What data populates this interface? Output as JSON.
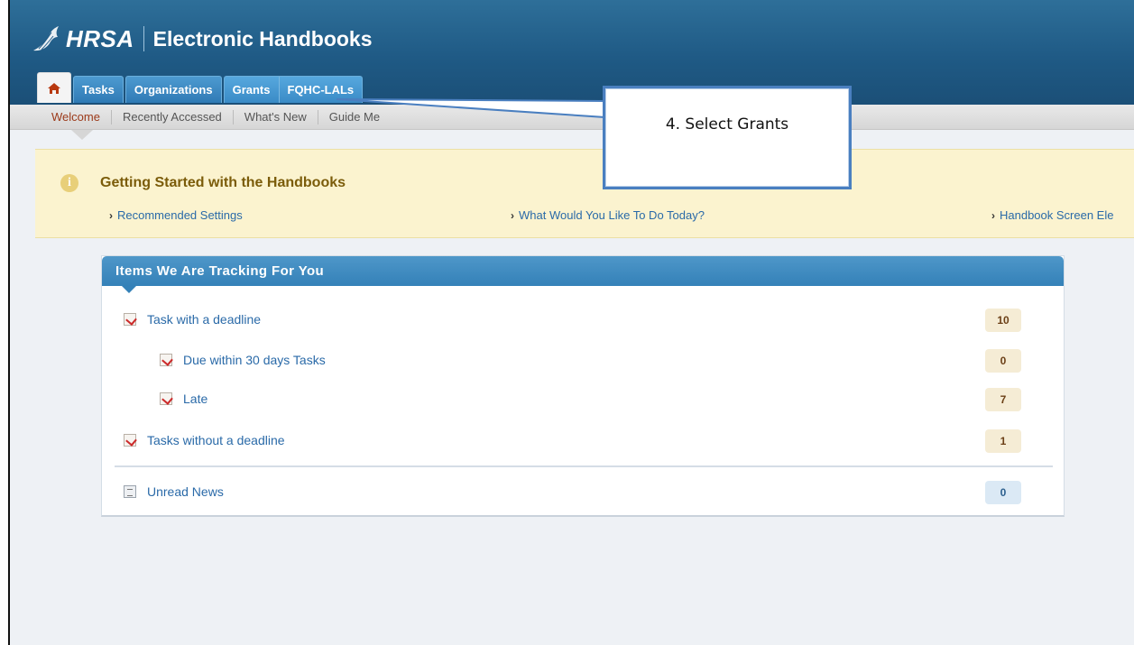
{
  "header": {
    "logo_text": "HRSA",
    "app_title": "Electronic Handbooks"
  },
  "tabs": [
    {
      "label": "Tasks"
    },
    {
      "label": "Organizations"
    },
    {
      "label": "Grants"
    },
    {
      "label": "FQHC-LALs"
    }
  ],
  "subnav": [
    {
      "label": "Welcome"
    },
    {
      "label": "Recently Accessed"
    },
    {
      "label": "What's New"
    },
    {
      "label": "Guide Me"
    }
  ],
  "banner": {
    "heading": "Getting Started with the Handbooks",
    "links": [
      {
        "label": "Recommended Settings"
      },
      {
        "label": "What Would You Like To Do Today?"
      },
      {
        "label": "Handbook Screen Ele"
      }
    ]
  },
  "callout": {
    "text": "4. Select Grants"
  },
  "tracking": {
    "title": "Items We Are Tracking For You",
    "rows": [
      {
        "label": "Task with a deadline",
        "count": "10"
      },
      {
        "label": "Due within 30 days Tasks",
        "count": "0"
      },
      {
        "label": "Late",
        "count": "7"
      },
      {
        "label": "Tasks without a deadline",
        "count": "1"
      },
      {
        "label": "Unread News",
        "count": "0"
      }
    ]
  },
  "colors": {
    "header_blue": "#1f5a85",
    "tab_blue": "#2f7ab5",
    "banner_bg": "#fbf3cf",
    "link_blue": "#2a6aa8",
    "callout_border": "#4a7fc0"
  }
}
